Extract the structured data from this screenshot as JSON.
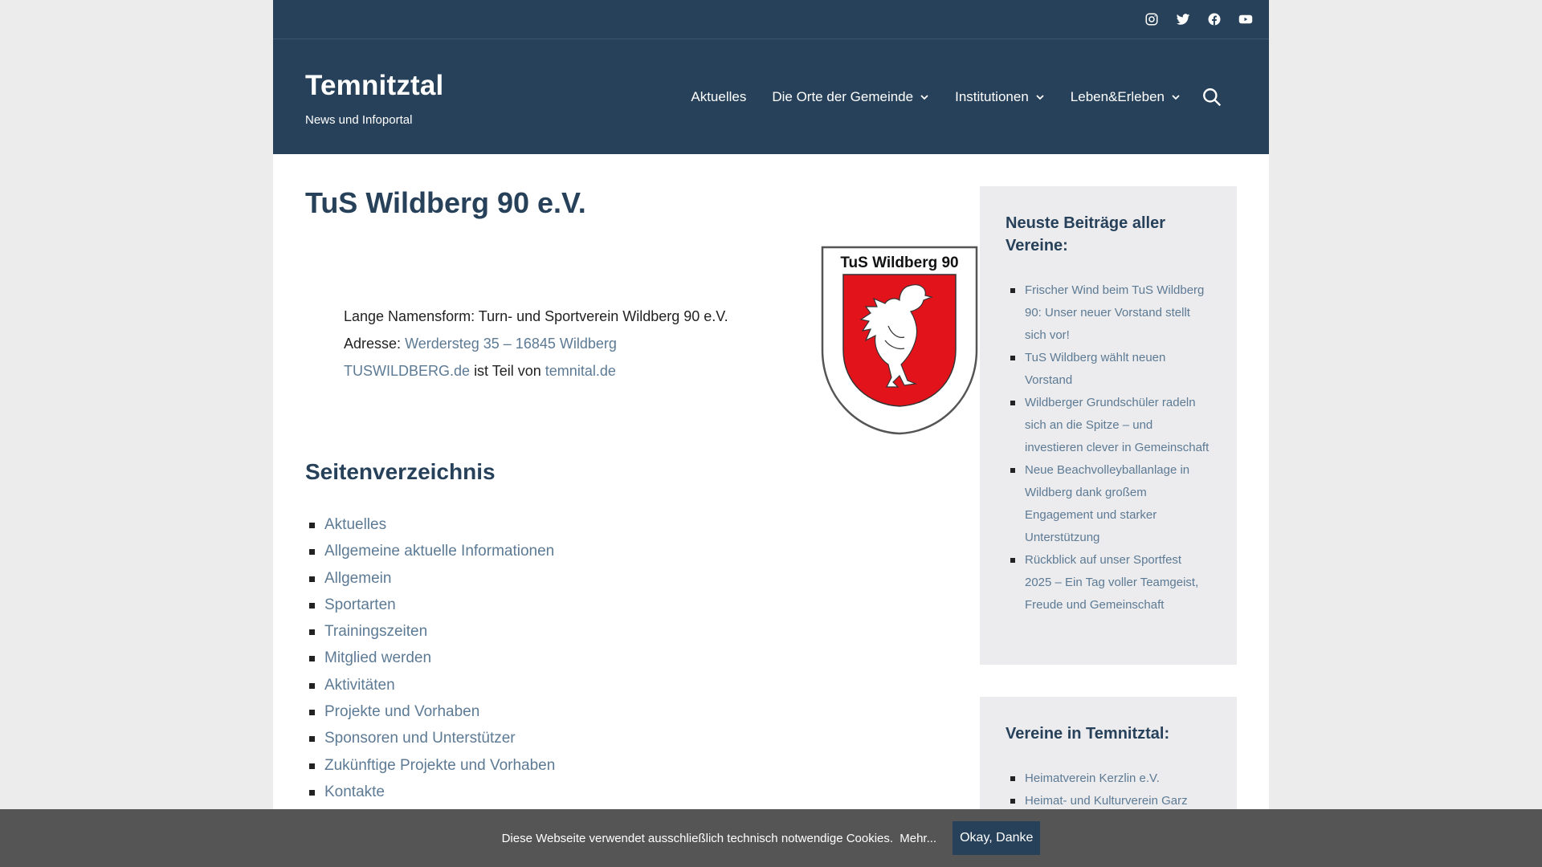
{
  "social": {
    "icons": [
      "instagram-icon",
      "twitter-icon",
      "facebook-icon",
      "youtube-icon"
    ]
  },
  "site": {
    "title": "Temnitztal",
    "tagline": "News und Infoportal"
  },
  "nav": {
    "items": [
      {
        "label": "Aktuelles",
        "has_dropdown": false
      },
      {
        "label": "Die Orte der Gemeinde",
        "has_dropdown": true
      },
      {
        "label": "Institutionen",
        "has_dropdown": true
      },
      {
        "label": "Leben&Erleben",
        "has_dropdown": true
      }
    ],
    "search_icon": "search-icon"
  },
  "main": {
    "title": "TuS Wildberg 90 e.V.",
    "crest": {
      "label": "TuS Wildberg 90",
      "colors": {
        "shield": "#e3131c",
        "outline": "#555555",
        "eagle": "#ffffff"
      }
    },
    "info": {
      "long_name_label": "Lange Namensform:",
      "long_name_value": "Turn- und Sportverein Wildberg 90 e.V.",
      "address_label": "Adresse:",
      "address_link": "Werdersteg 35 – 16845 Wildberg",
      "site_link": "TUSWILDBERG.de",
      "part_of_text": "ist Teil von",
      "part_of_link": "temnital.de"
    },
    "toc_title": "Seitenverzeichnis",
    "toc": [
      "Aktuelles",
      "Allgemeine aktuelle Informationen",
      "Allgemein",
      "Sportarten",
      "Trainingszeiten",
      "Mitglied werden",
      "Aktivitäten",
      "Projekte und Vorhaben",
      "Sponsoren und Unterstützer",
      "Zukünftige Projekte und Vorhaben",
      "Kontakte"
    ]
  },
  "sidebar": {
    "recent": {
      "title": "Neuste Beiträge aller Vereine:",
      "posts": [
        "Frischer Wind beim TuS Wildberg 90: Unser neuer Vorstand stellt sich vor!",
        "TuS Wildberg wählt neuen Vorstand",
        "Wildberger Grundschüler radeln sich an die Spitze – und investieren clever in Gemeinschaft",
        "Neue Beachvolleyballanlage in Wildberg dank großem Engagement und starker Unterstützung",
        "Rückblick auf unser Sportfest 2025 – Ein Tag voller Teamgeist, Freude und Gemeinschaft"
      ]
    },
    "clubs": {
      "title": "Vereine in Temnitztal:",
      "items": [
        "Heimatverein Kerzlin e.V.",
        "Heimat- und Kulturverein Garz"
      ]
    }
  },
  "cookie": {
    "text": "Diese Webseite verwendet ausschließlich technisch notwendige Cookies.",
    "more": "Mehr...",
    "button": "Okay, Danke"
  },
  "colors": {
    "header_bg": "#264159",
    "accent_link": "#5d7a94",
    "cookie_bar": "#555555",
    "widget_bg": "#ececee"
  }
}
